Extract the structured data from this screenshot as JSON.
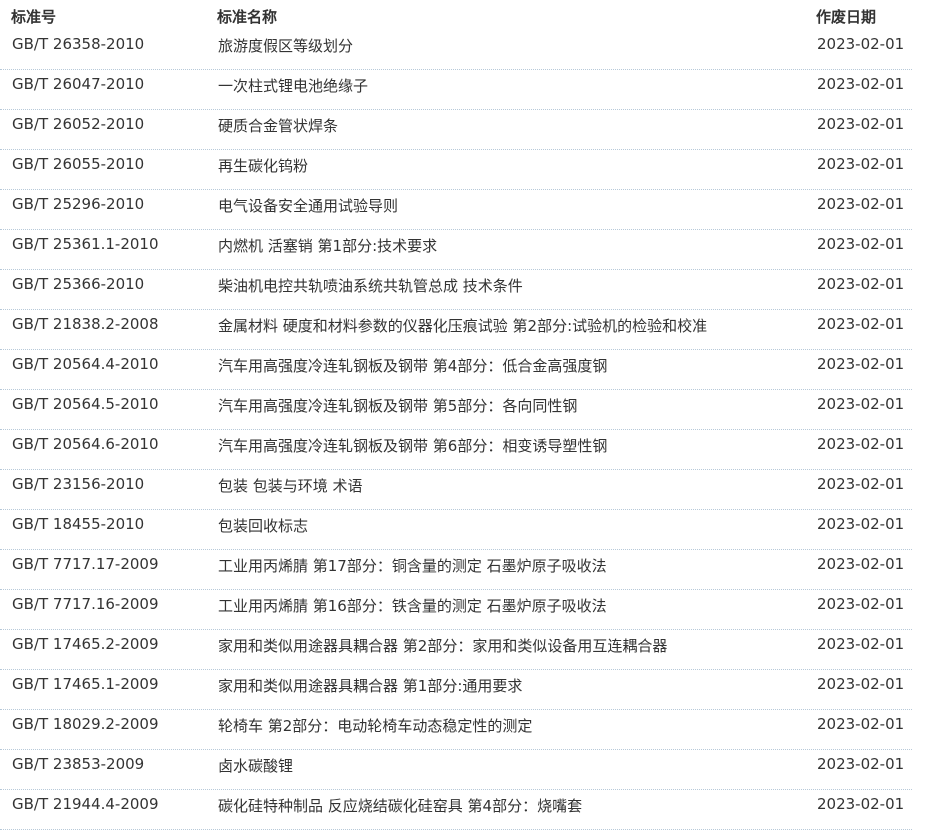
{
  "header": {
    "col_number": "标准号",
    "col_name": "标准名称",
    "col_date": "作废日期"
  },
  "rows": [
    {
      "number": "GB/T 26358-2010",
      "name": "旅游度假区等级划分",
      "date": "2023-02-01"
    },
    {
      "number": "GB/T 26047-2010",
      "name": "一次柱式锂电池绝缘子",
      "date": "2023-02-01"
    },
    {
      "number": "GB/T 26052-2010",
      "name": "硬质合金管状焊条",
      "date": "2023-02-01"
    },
    {
      "number": "GB/T 26055-2010",
      "name": "再生碳化钨粉",
      "date": "2023-02-01"
    },
    {
      "number": "GB/T 25296-2010",
      "name": "电气设备安全通用试验导则",
      "date": "2023-02-01"
    },
    {
      "number": "GB/T 25361.1-2010",
      "name": "内燃机 活塞销 第1部分:技术要求",
      "date": "2023-02-01"
    },
    {
      "number": "GB/T 25366-2010",
      "name": "柴油机电控共轨喷油系统共轨管总成 技术条件",
      "date": "2023-02-01"
    },
    {
      "number": "GB/T 21838.2-2008",
      "name": "金属材料 硬度和材料参数的仪器化压痕试验 第2部分:试验机的检验和校准",
      "date": "2023-02-01"
    },
    {
      "number": "GB/T 20564.4-2010",
      "name": "汽车用高强度冷连轧钢板及钢带 第4部分：低合金高强度钢",
      "date": "2023-02-01"
    },
    {
      "number": "GB/T 20564.5-2010",
      "name": "汽车用高强度冷连轧钢板及钢带 第5部分：各向同性钢",
      "date": "2023-02-01"
    },
    {
      "number": "GB/T 20564.6-2010",
      "name": "汽车用高强度冷连轧钢板及钢带 第6部分：相变诱导塑性钢",
      "date": "2023-02-01"
    },
    {
      "number": "GB/T 23156-2010",
      "name": "包装 包装与环境 术语",
      "date": "2023-02-01"
    },
    {
      "number": "GB/T 18455-2010",
      "name": "包装回收标志",
      "date": "2023-02-01"
    },
    {
      "number": "GB/T 7717.17-2009",
      "name": "工业用丙烯腈 第17部分：铜含量的测定 石墨炉原子吸收法",
      "date": "2023-02-01"
    },
    {
      "number": "GB/T 7717.16-2009",
      "name": "工业用丙烯腈 第16部分：铁含量的测定 石墨炉原子吸收法",
      "date": "2023-02-01"
    },
    {
      "number": "GB/T 17465.2-2009",
      "name": "家用和类似用途器具耦合器 第2部分：家用和类似设备用互连耦合器",
      "date": "2023-02-01"
    },
    {
      "number": "GB/T 17465.1-2009",
      "name": "家用和类似用途器具耦合器 第1部分:通用要求",
      "date": "2023-02-01"
    },
    {
      "number": "GB/T 18029.2-2009",
      "name": "轮椅车 第2部分：电动轮椅车动态稳定性的测定",
      "date": "2023-02-01"
    },
    {
      "number": "GB/T 23853-2009",
      "name": "卤水碳酸锂",
      "date": "2023-02-01"
    },
    {
      "number": "GB/T 21944.4-2009",
      "name": "碳化硅特种制品 反应烧结碳化硅窑具 第4部分：烧嘴套",
      "date": "2023-02-01"
    }
  ]
}
